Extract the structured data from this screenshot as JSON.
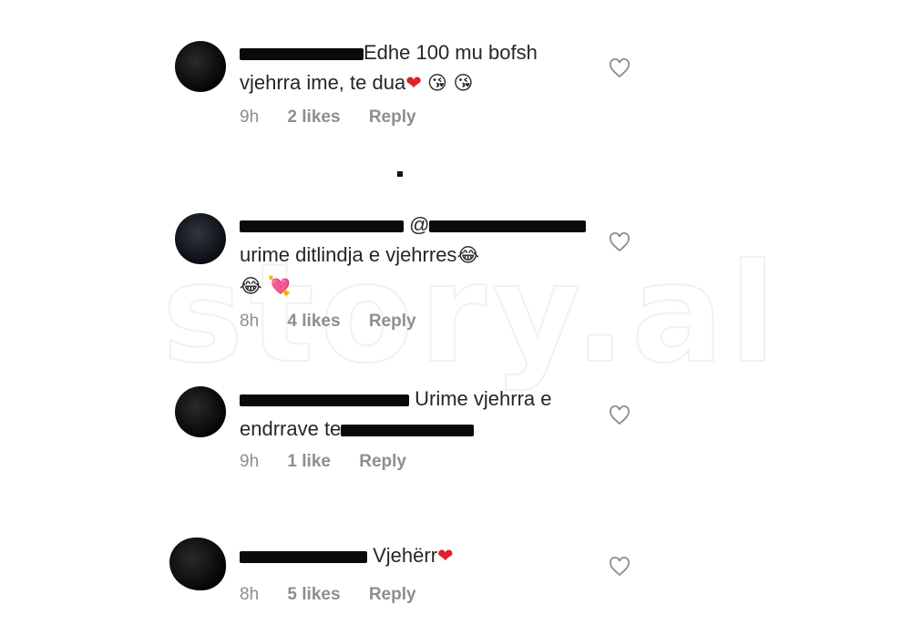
{
  "watermark": "story.al",
  "comments": [
    {
      "text": "Edhe 100 mu bofsh vjehrra ime, te dua",
      "emojis": "❤️ 😘 😘",
      "time": "9h",
      "likes": "2 likes",
      "reply": "Reply"
    },
    {
      "mention_prefix": "@",
      "text": "urime ditlindja e vjehrres",
      "emojis": "😂 😂 💘",
      "time": "8h",
      "likes": "4 likes",
      "reply": "Reply"
    },
    {
      "text": "Urime vjehrra e endrrave te",
      "time": "9h",
      "likes": "1 like",
      "reply": "Reply"
    },
    {
      "text": "Vjehërr",
      "emojis": "❤️",
      "time": "8h",
      "likes": "5 likes",
      "reply": "Reply"
    }
  ],
  "icons": {
    "like": "heart-outline-icon",
    "heart_color": "#e0202b",
    "meta_color": "#8e8e8e"
  }
}
